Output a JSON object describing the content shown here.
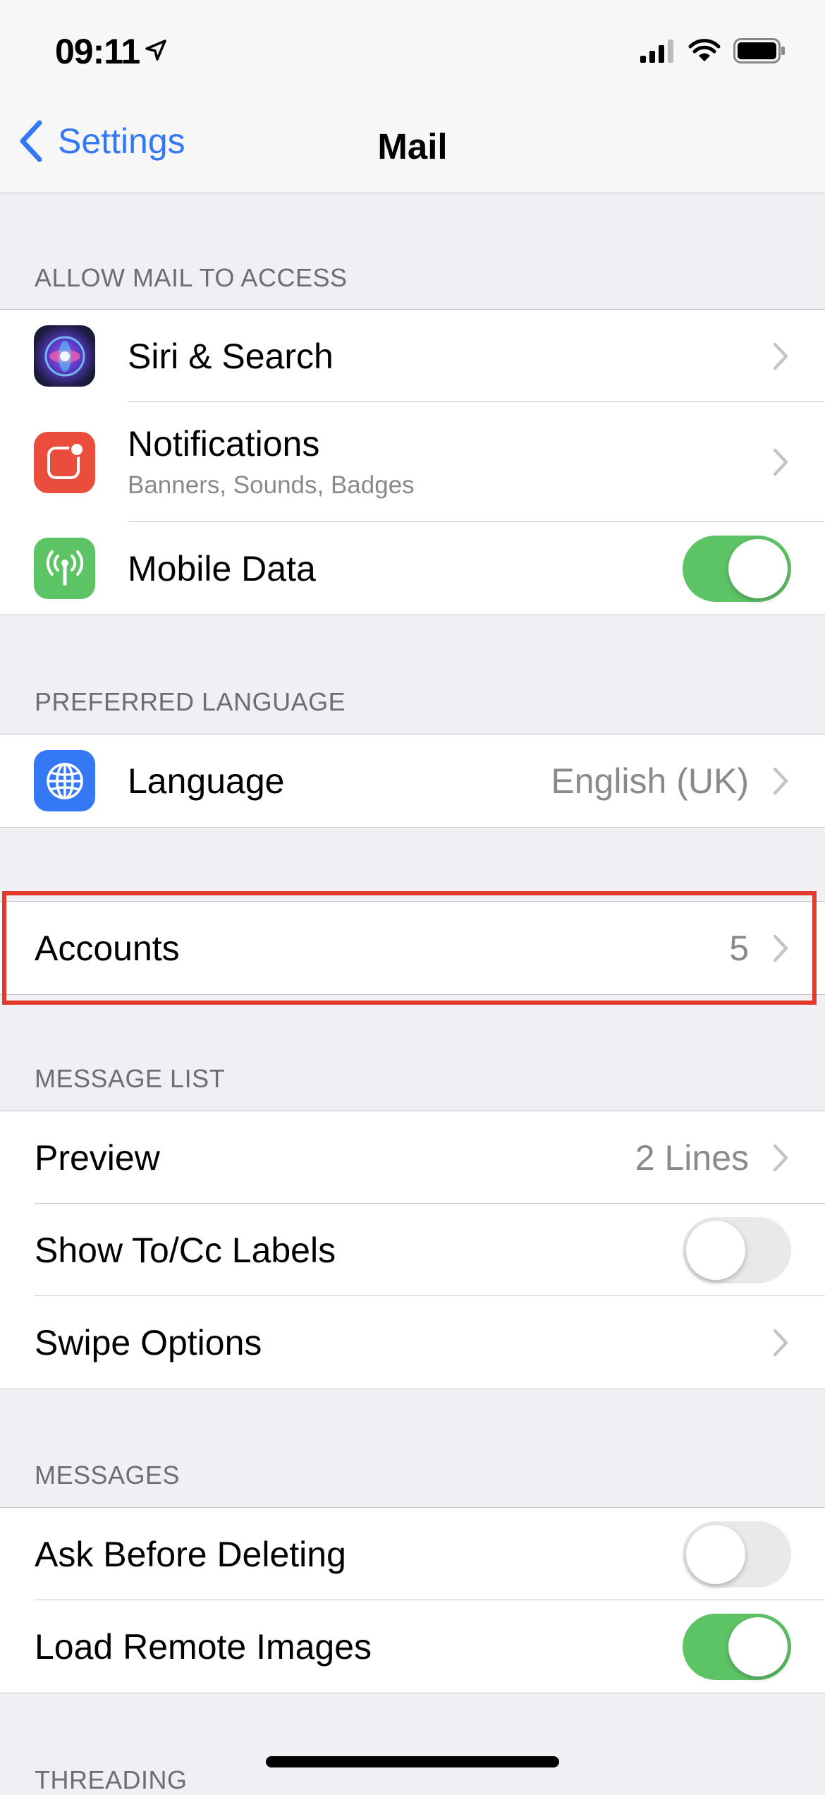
{
  "status_bar": {
    "time": "09:11"
  },
  "nav": {
    "back_label": "Settings",
    "title": "Mail"
  },
  "sections": {
    "allow": {
      "header": "ALLOW MAIL TO ACCESS",
      "siri": {
        "label": "Siri & Search",
        "icon": "siri-icon"
      },
      "notifications": {
        "label": "Notifications",
        "sublabel": "Banners, Sounds, Badges",
        "icon": "notifications-icon"
      },
      "mobile_data": {
        "label": "Mobile Data",
        "icon": "antenna-icon",
        "enabled": true
      }
    },
    "language": {
      "header": "PREFERRED LANGUAGE",
      "language": {
        "label": "Language",
        "value": "English (UK)",
        "icon": "globe-icon"
      }
    },
    "accounts": {
      "label": "Accounts",
      "value": "5"
    },
    "message_list": {
      "header": "MESSAGE LIST",
      "preview": {
        "label": "Preview",
        "value": "2 Lines"
      },
      "show_tocc": {
        "label": "Show To/Cc Labels",
        "enabled": false
      },
      "swipe": {
        "label": "Swipe Options"
      }
    },
    "messages": {
      "header": "MESSAGES",
      "ask_delete": {
        "label": "Ask Before Deleting",
        "enabled": false
      },
      "remote_images": {
        "label": "Load Remote Images",
        "enabled": true
      }
    },
    "threading": {
      "header": "THREADING"
    }
  },
  "colors": {
    "accent": "#3478f6",
    "toggle_on": "#5dc466",
    "highlight": "#e23b2e"
  }
}
